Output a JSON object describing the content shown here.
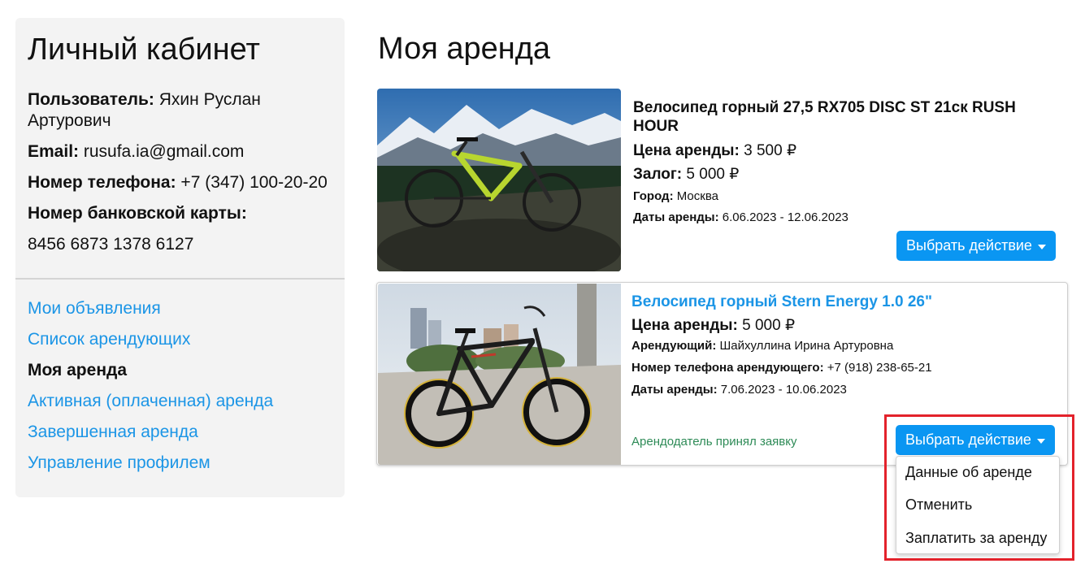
{
  "sidebar": {
    "title": "Личный кабинет",
    "user_label": "Пользователь:",
    "user_value": " Яхин Руслан Артурович",
    "email_label": "Email:",
    "email_value": " rusufa.ia@gmail.com",
    "phone_label": "Номер телефона:",
    "phone_value": " +7 (347) 100-20-20",
    "card_label": "Номер банковской карты:",
    "card_value": "8456 6873 1378 6127",
    "nav": [
      {
        "label": "Мои объявления"
      },
      {
        "label": "Список арендующих"
      },
      {
        "label": "Моя аренда"
      },
      {
        "label": "Активная (оплаченная) аренда"
      },
      {
        "label": "Завершенная аренда"
      },
      {
        "label": "Управление профилем"
      }
    ]
  },
  "main": {
    "title": "Моя аренда",
    "cards": [
      {
        "title": "Велосипед горный 27,5 RX705 DISC ST 21ск RUSH HOUR",
        "price_label": "Цена аренды:",
        "price_value": " 3 500 ₽",
        "deposit_label": "Залог:",
        "deposit_value": " 5 000 ₽",
        "city_label": "Город:",
        "city_value": " Москва",
        "dates_label": "Даты аренды:",
        "dates_value": " 6.06.2023 - 12.06.2023",
        "action_label": "Выбрать действие"
      },
      {
        "title": "Велосипед горный Stern Energy 1.0 26\"",
        "price_label": "Цена аренды:",
        "price_value": " 5 000 ₽",
        "renter_label": "Арендующий:",
        "renter_value": " Шайхуллина Ирина Артуровна",
        "renter_phone_label": "Номер телефона арендующего:",
        "renter_phone_value": " +7 (918) 238-65-21",
        "dates_label": "Даты аренды:",
        "dates_value": " 7.06.2023 - 10.06.2023",
        "status": "Арендодатель принял заявку",
        "action_label": "Выбрать действие",
        "dropdown": [
          "Данные об аренде",
          "Отменить",
          "Заплатить за аренду"
        ]
      }
    ]
  },
  "colors": {
    "accent": "#0a96f2",
    "link": "#1b95e6",
    "status": "#2e8b57",
    "highlight": "#e3222b"
  }
}
